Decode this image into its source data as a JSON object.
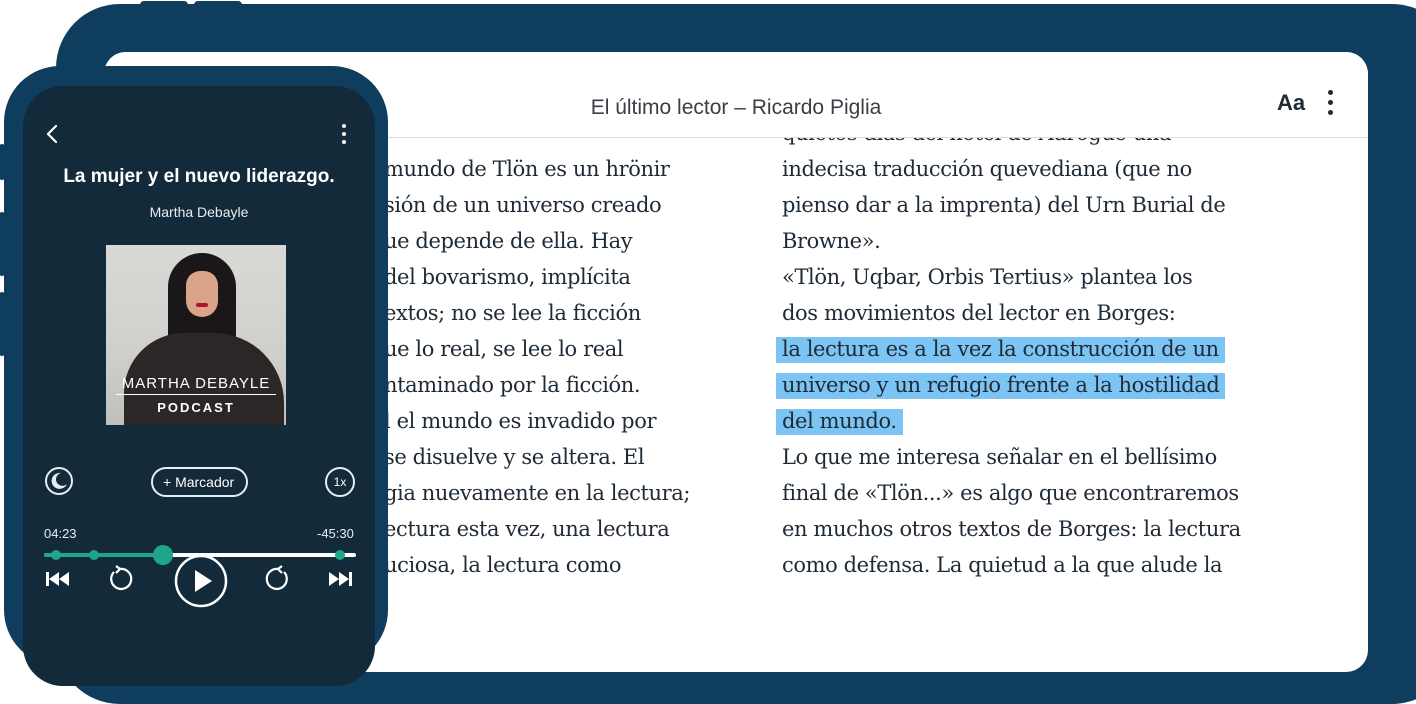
{
  "reader": {
    "book_title": "El último lector – Ricardo Piglia",
    "font_button": "Aa",
    "left_column": [
      "mundo de Tlön es un hrönir",
      "sión de un universo creado",
      "ue depende de ella. Hay",
      "del bovarismo, implícita",
      "extos; no se lee la ficción",
      "ue lo real, se lee lo real",
      "ntaminado por la ficción.",
      "l el mundo es invadido por",
      "se disuelve y se altera. El",
      "gia nuevamente en la lectura;",
      "ectura esta vez, una lectura",
      "uciosa, la lectura como"
    ],
    "right_column": [
      "quietos días del hotel de Adrogué una",
      "indecisa traducción quevediana (que no",
      "pienso dar a la imprenta) del Urn Burial de",
      "Browne».",
      "  «Tlön, Uqbar, Orbis Tertius» plantea los",
      "dos movimientos del lector en Borges:",
      "la lectura es a la vez la construcción de un",
      "universo y un refugio frente a la hostilidad",
      "del mundo.",
      "  Lo que me interesa señalar en el bellísimo",
      "final de «Tlön...» es algo que encontraremos",
      "en muchos otros textos de Borges: la lectura",
      "como defensa. La quietud a la que alude la"
    ],
    "highlighted_lines": [
      6,
      7,
      8
    ],
    "highlight_color": "#7cc4f4"
  },
  "player": {
    "episode_title": "La mujer y el nuevo liderazgo.",
    "author": "Martha Debayle",
    "cover_name": "MARTHA DEBAYLE",
    "cover_subtitle": "PODCAST",
    "bookmark_label": "+ Marcador",
    "speed_label": "1x",
    "elapsed": "04:23",
    "remaining": "-45:30",
    "progress_fraction": 0.38,
    "chapter_markers": [
      0.04,
      0.16,
      0.95
    ],
    "accent_color": "#1fa58a",
    "icons": [
      "back-icon",
      "more-vert-icon",
      "sleep-timer-icon",
      "skip-previous-icon",
      "rewind-15-icon",
      "play-icon",
      "forward-15-icon",
      "skip-next-icon"
    ]
  },
  "colors": {
    "device_frame": "#0e3d5e",
    "player_bg": "#132a3a"
  }
}
